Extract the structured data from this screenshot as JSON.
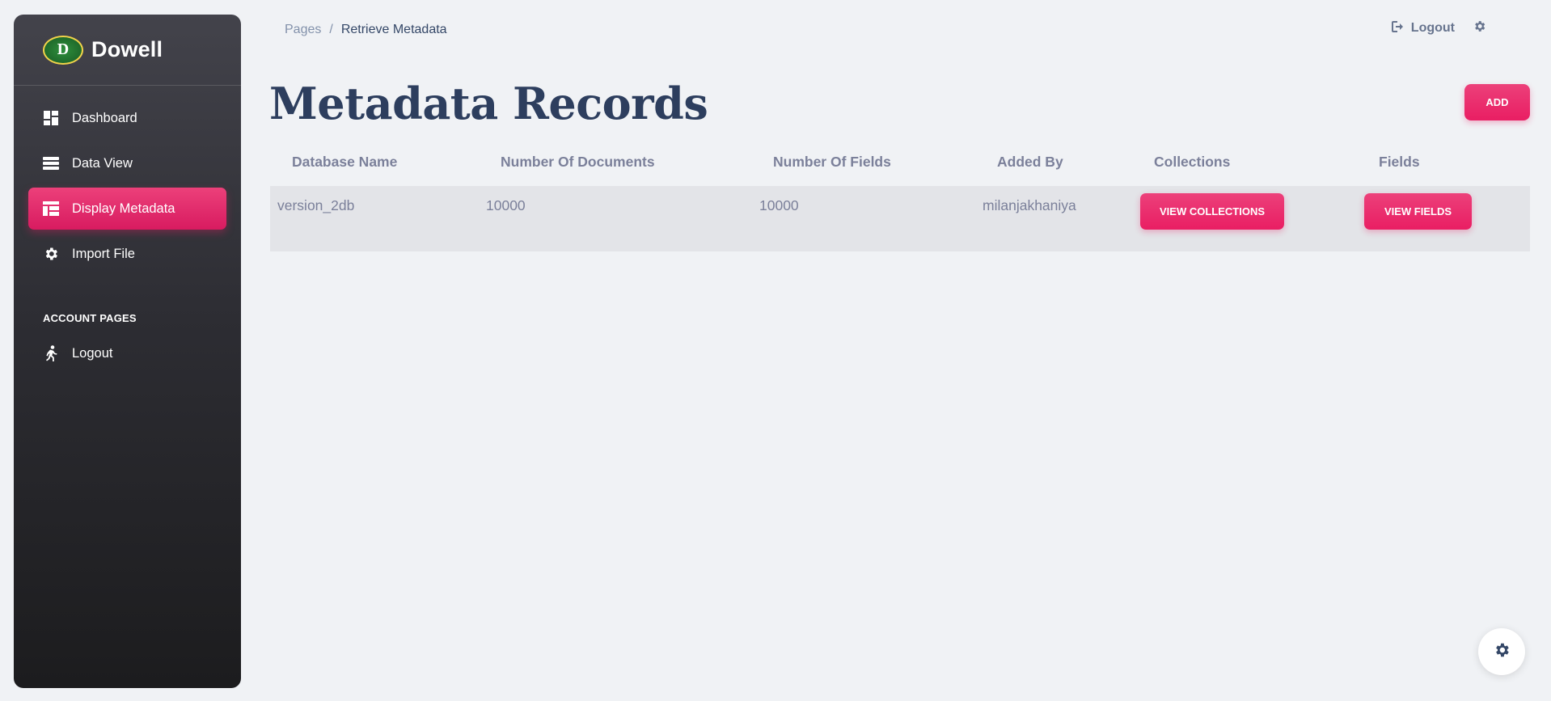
{
  "brand": {
    "name": "Dowell",
    "logo_text": "D"
  },
  "sidebar": {
    "items": [
      {
        "label": "Dashboard",
        "icon": "dashboard-icon"
      },
      {
        "label": "Data View",
        "icon": "list-icon"
      },
      {
        "label": "Display Metadata",
        "icon": "table-icon",
        "active": true
      },
      {
        "label": "Import File",
        "icon": "gear-icon"
      }
    ],
    "section_title": "ACCOUNT PAGES",
    "account_items": [
      {
        "label": "Logout",
        "icon": "running-person-icon"
      }
    ]
  },
  "breadcrumb": {
    "root": "Pages",
    "separator": "/",
    "current": "Retrieve Metadata"
  },
  "topbar": {
    "logout_label": "Logout"
  },
  "main": {
    "title": "Metadata Records",
    "add_label": "ADD",
    "table": {
      "headers": [
        "Database Name",
        "Number Of Documents",
        "Number Of Fields",
        "Added By",
        "Collections",
        "Fields"
      ],
      "rows": [
        {
          "database_name": "version_2db",
          "number_of_documents": "10000",
          "number_of_fields": "10000",
          "added_by": "milanjakhaniya",
          "collections_button": "VIEW COLLECTIONS",
          "fields_button": "VIEW FIELDS"
        }
      ]
    }
  },
  "colors": {
    "accent": "#e91e63",
    "title": "#2d3e5e",
    "sidebar_dark": "#1c1c1e"
  }
}
